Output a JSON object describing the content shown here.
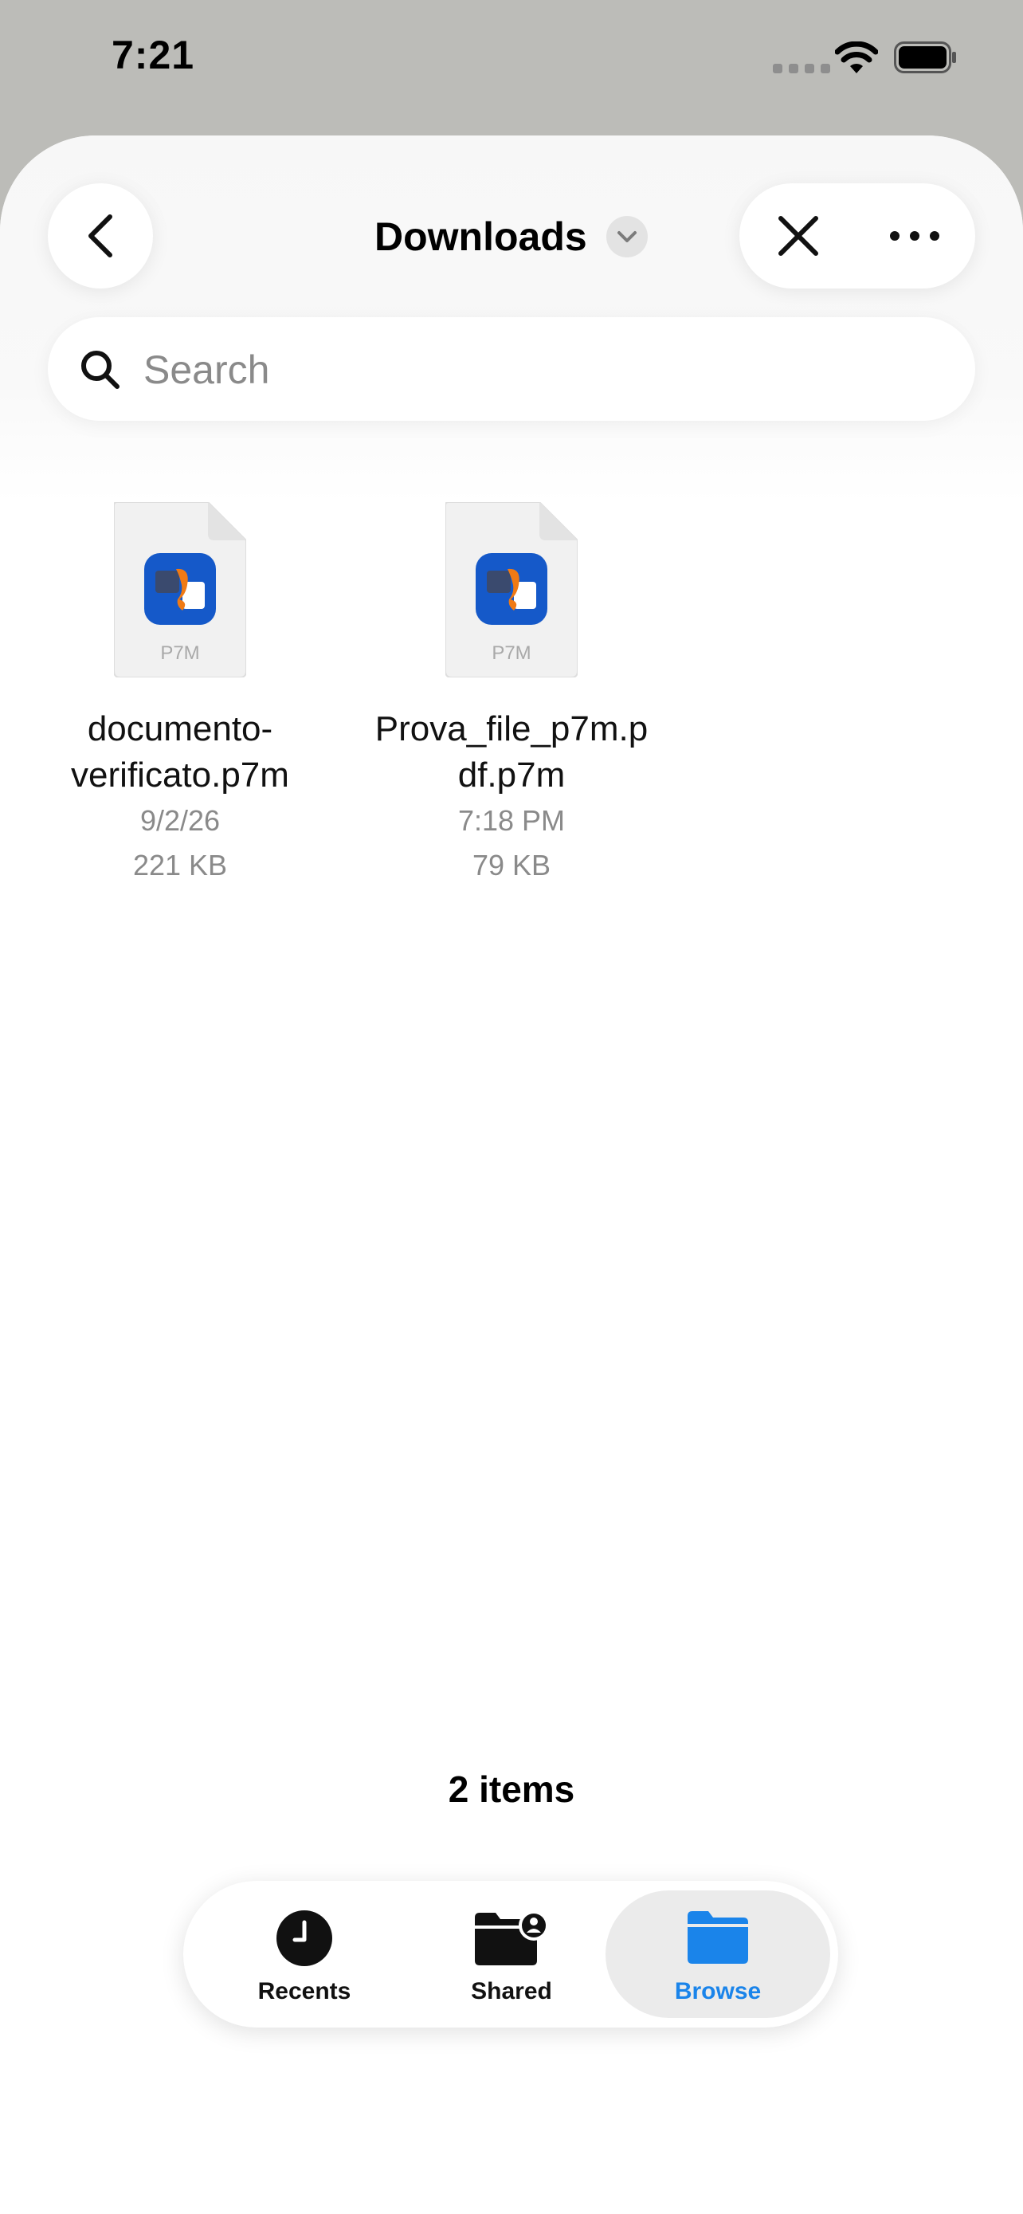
{
  "status_bar": {
    "time": "7:21",
    "icons": [
      "cellular-signal-icon",
      "wifi-icon",
      "battery-icon"
    ]
  },
  "nav": {
    "title": "Downloads",
    "back_icon": "chevron-left-icon",
    "title_menu_icon": "chevron-down-icon",
    "close_icon": "close-icon",
    "more_icon": "ellipsis-icon"
  },
  "search": {
    "placeholder": "Search",
    "value": ""
  },
  "files": [
    {
      "name": "documento-verificato.p7m",
      "name_lines": [
        "documento-",
        "verificato.p7m"
      ],
      "date": "9/2/26",
      "size": "221 KB",
      "ext": "P7M"
    },
    {
      "name": "Prova_file_p7m.pdf.p7m",
      "name_lines": [
        "Prova_file_p7m.p",
        "df.p7m"
      ],
      "date": "7:18 PM",
      "size": "79 KB",
      "ext": "P7M"
    }
  ],
  "footer": {
    "items_count": "2 items"
  },
  "tabs": [
    {
      "label": "Recents",
      "icon": "clock-icon",
      "selected": false
    },
    {
      "label": "Shared",
      "icon": "shared-folder-icon",
      "selected": false
    },
    {
      "label": "Browse",
      "icon": "folder-icon",
      "selected": true
    }
  ],
  "colors": {
    "accent": "#1a84ea",
    "sheet_background": "#ffffff",
    "backdrop": "#bcbcb8",
    "secondary_text": "#8a8a8a"
  }
}
